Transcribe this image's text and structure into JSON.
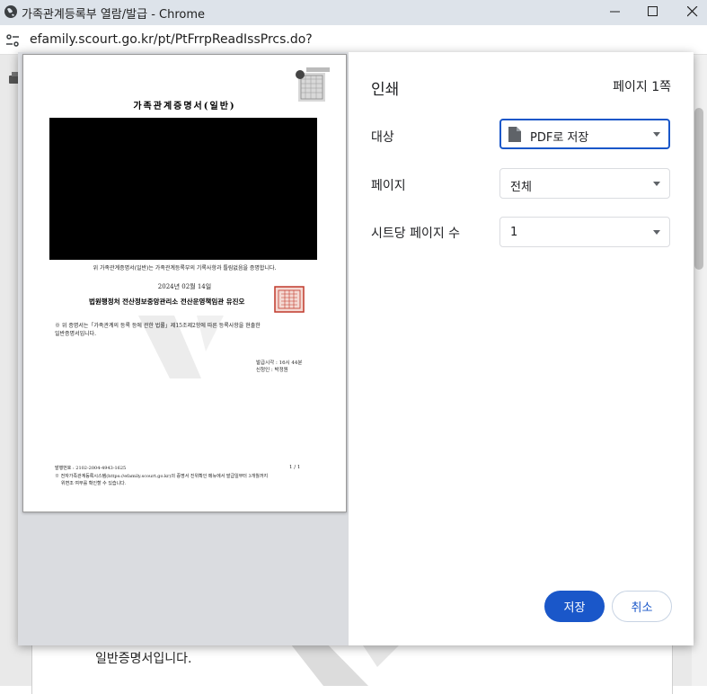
{
  "window": {
    "title": "가족관계등록부 열람/발급 - Chrome",
    "url": "efamily.scourt.go.kr/pt/PtFrrpReadIssPrcs.do?"
  },
  "background_page": {
    "text_line": "일반증명서입니다."
  },
  "print_dialog": {
    "title": "인쇄",
    "page_count": "페이지 1쪽",
    "destination": {
      "label": "대상",
      "value": "PDF로 저장"
    },
    "pages": {
      "label": "페이지",
      "value": "전체"
    },
    "pages_per_sheet": {
      "label": "시트당 페이지 수",
      "value": "1"
    },
    "save_label": "저장",
    "cancel_label": "취소",
    "accent_color": "#1a57c9"
  },
  "preview": {
    "doc_title": "가족관계증명서(일반)",
    "cert_text": "위 가족관계증명서(일반)는 가족관계등록부의 기록사항과 틀림없음을 증명합니다.",
    "date": "2024년 02월 14일",
    "issuer": "법원행정처 전산정보중앙관리소 전산운영책임관 유진오",
    "note_line1": "※ 위 증명서는「가족관계의 등록 등에 관한 법률」제15조제2항에 따른 등록사항을 현출한",
    "note_line2": "일반증명서입니다.",
    "issue_time": "발급시각 : 16시 44분",
    "applicant": "신청인 : 박정원",
    "footer_issue_no": "발행번호 : 2102-2004-4943-1625",
    "page_number": "1 / 1",
    "footer_line1": "※ 전자가족관계등록시스템(https://efamily.scourt.go.kr)의 증명서 진위확인 메뉴에서 발급일부터 3개월까지",
    "footer_line2": "위변조 여부를 확인할 수 있습니다."
  }
}
